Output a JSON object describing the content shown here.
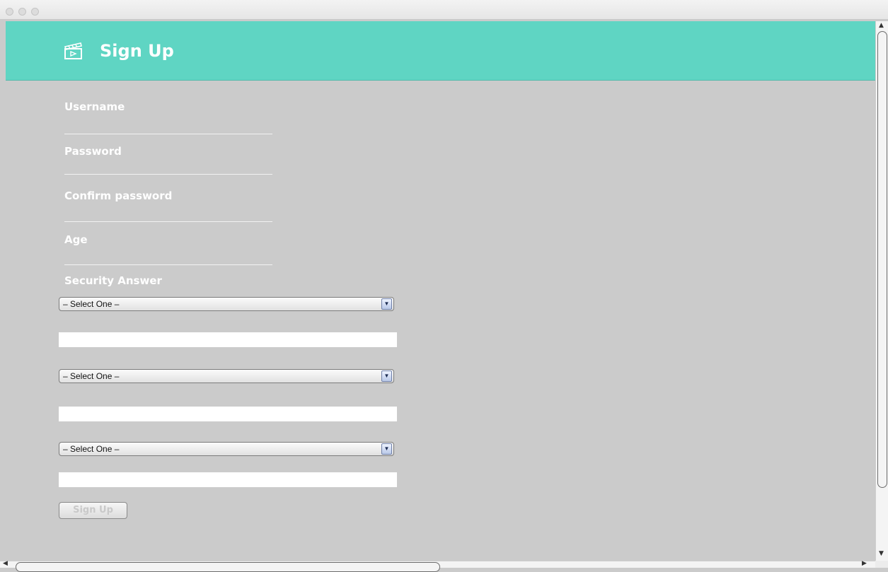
{
  "window": {
    "buttons": [
      "close",
      "minimize",
      "zoom"
    ]
  },
  "header": {
    "title": "Sign Up",
    "icon": "clapperboard-icon",
    "accent_color": "#5fd5c3"
  },
  "form": {
    "username_label": "Username",
    "password_label": "Password",
    "confirm_password_label": "Confirm password",
    "age_label": "Age",
    "security_answer_label": "Security Answer",
    "questions": [
      {
        "selected": "– Select One –",
        "answer": ""
      },
      {
        "selected": "– Select One –",
        "answer": ""
      },
      {
        "selected": "– Select One –",
        "answer": ""
      }
    ],
    "submit_label": "Sign Up"
  }
}
